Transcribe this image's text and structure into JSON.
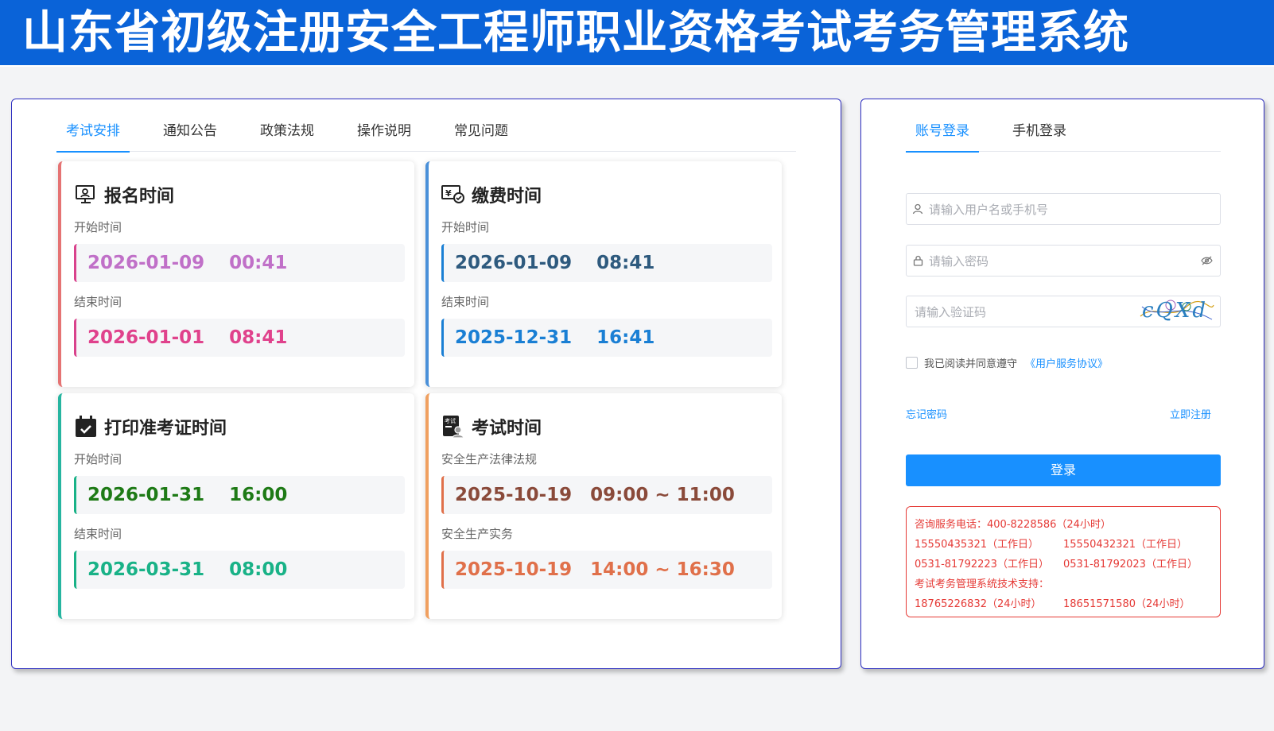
{
  "header": {
    "title": "山东省初级注册安全工程师职业资格考试考务管理系统"
  },
  "left": {
    "tabs": [
      {
        "label": "考试安排",
        "active": true
      },
      {
        "label": "通知公告",
        "active": false
      },
      {
        "label": "政策法规",
        "active": false
      },
      {
        "label": "操作说明",
        "active": false
      },
      {
        "label": "常见问题",
        "active": false
      }
    ],
    "cards": {
      "signup": {
        "title": "报名时间",
        "icon": "monitor-icon",
        "accent": "#e57373",
        "label1": "开始时间",
        "value1": "2026-01-09　 00:41",
        "color1": "#c070c8",
        "label2": "结束时间",
        "value2": "2026-01-01　 08:41",
        "color2": "#e0428c"
      },
      "payment": {
        "title": "缴费时间",
        "icon": "payment-icon",
        "accent": "#4a90d9",
        "label1": "开始时间",
        "value1": "2026-01-09　 08:41",
        "color1": "#2e5a7e",
        "label2": "结束时间",
        "value2": "2025-12-31　 16:41",
        "color2": "#1a7fd4"
      },
      "print": {
        "title": "打印准考证时间",
        "icon": "calendar-check-icon",
        "accent": "#26b5a0",
        "label1": "开始时间",
        "value1": "2026-01-31　 16:00",
        "color1": "#1e7a16",
        "label2": "结束时间",
        "value2": "2026-03-31　 08:00",
        "color2": "#19b287"
      },
      "exam": {
        "title": "考试时间",
        "icon": "exam-icon",
        "accent": "#f0a060",
        "label1": "安全生产法律法规",
        "value1": "2025-10-19　09:00 ~ 11:00",
        "color1": "#8a4a3a",
        "label2": "安全生产实务",
        "value2": "2025-10-19　14:00 ~ 16:30",
        "color2": "#e0704a"
      }
    }
  },
  "login": {
    "tabs": [
      {
        "label": "账号登录",
        "active": true
      },
      {
        "label": "手机登录",
        "active": false
      }
    ],
    "username_placeholder": "请输入用户名或手机号",
    "password_placeholder": "请输入密码",
    "captcha_placeholder": "请输入验证码",
    "captcha_text": "cQXd",
    "agree_text": "我已阅读并同意遵守",
    "agreement_link": "《用户服务协议》",
    "forgot_password": "忘记密码",
    "register": "立即注册",
    "login_button": "登录",
    "accent": "#1890ff"
  },
  "contact": {
    "line1": "咨询服务电话：400-8228586（24小时）",
    "phone_a": "15550435321（工作日）",
    "phone_b": "15550432321（工作日）",
    "phone_c": "0531-81792223（工作日）",
    "phone_d": "0531-81792023（工作日）",
    "support_label": "考试考务管理系统技术支持：",
    "phone_e": "18765226832（24小时）",
    "phone_f": "18651571580（24小时）",
    "color": "#e53935"
  }
}
